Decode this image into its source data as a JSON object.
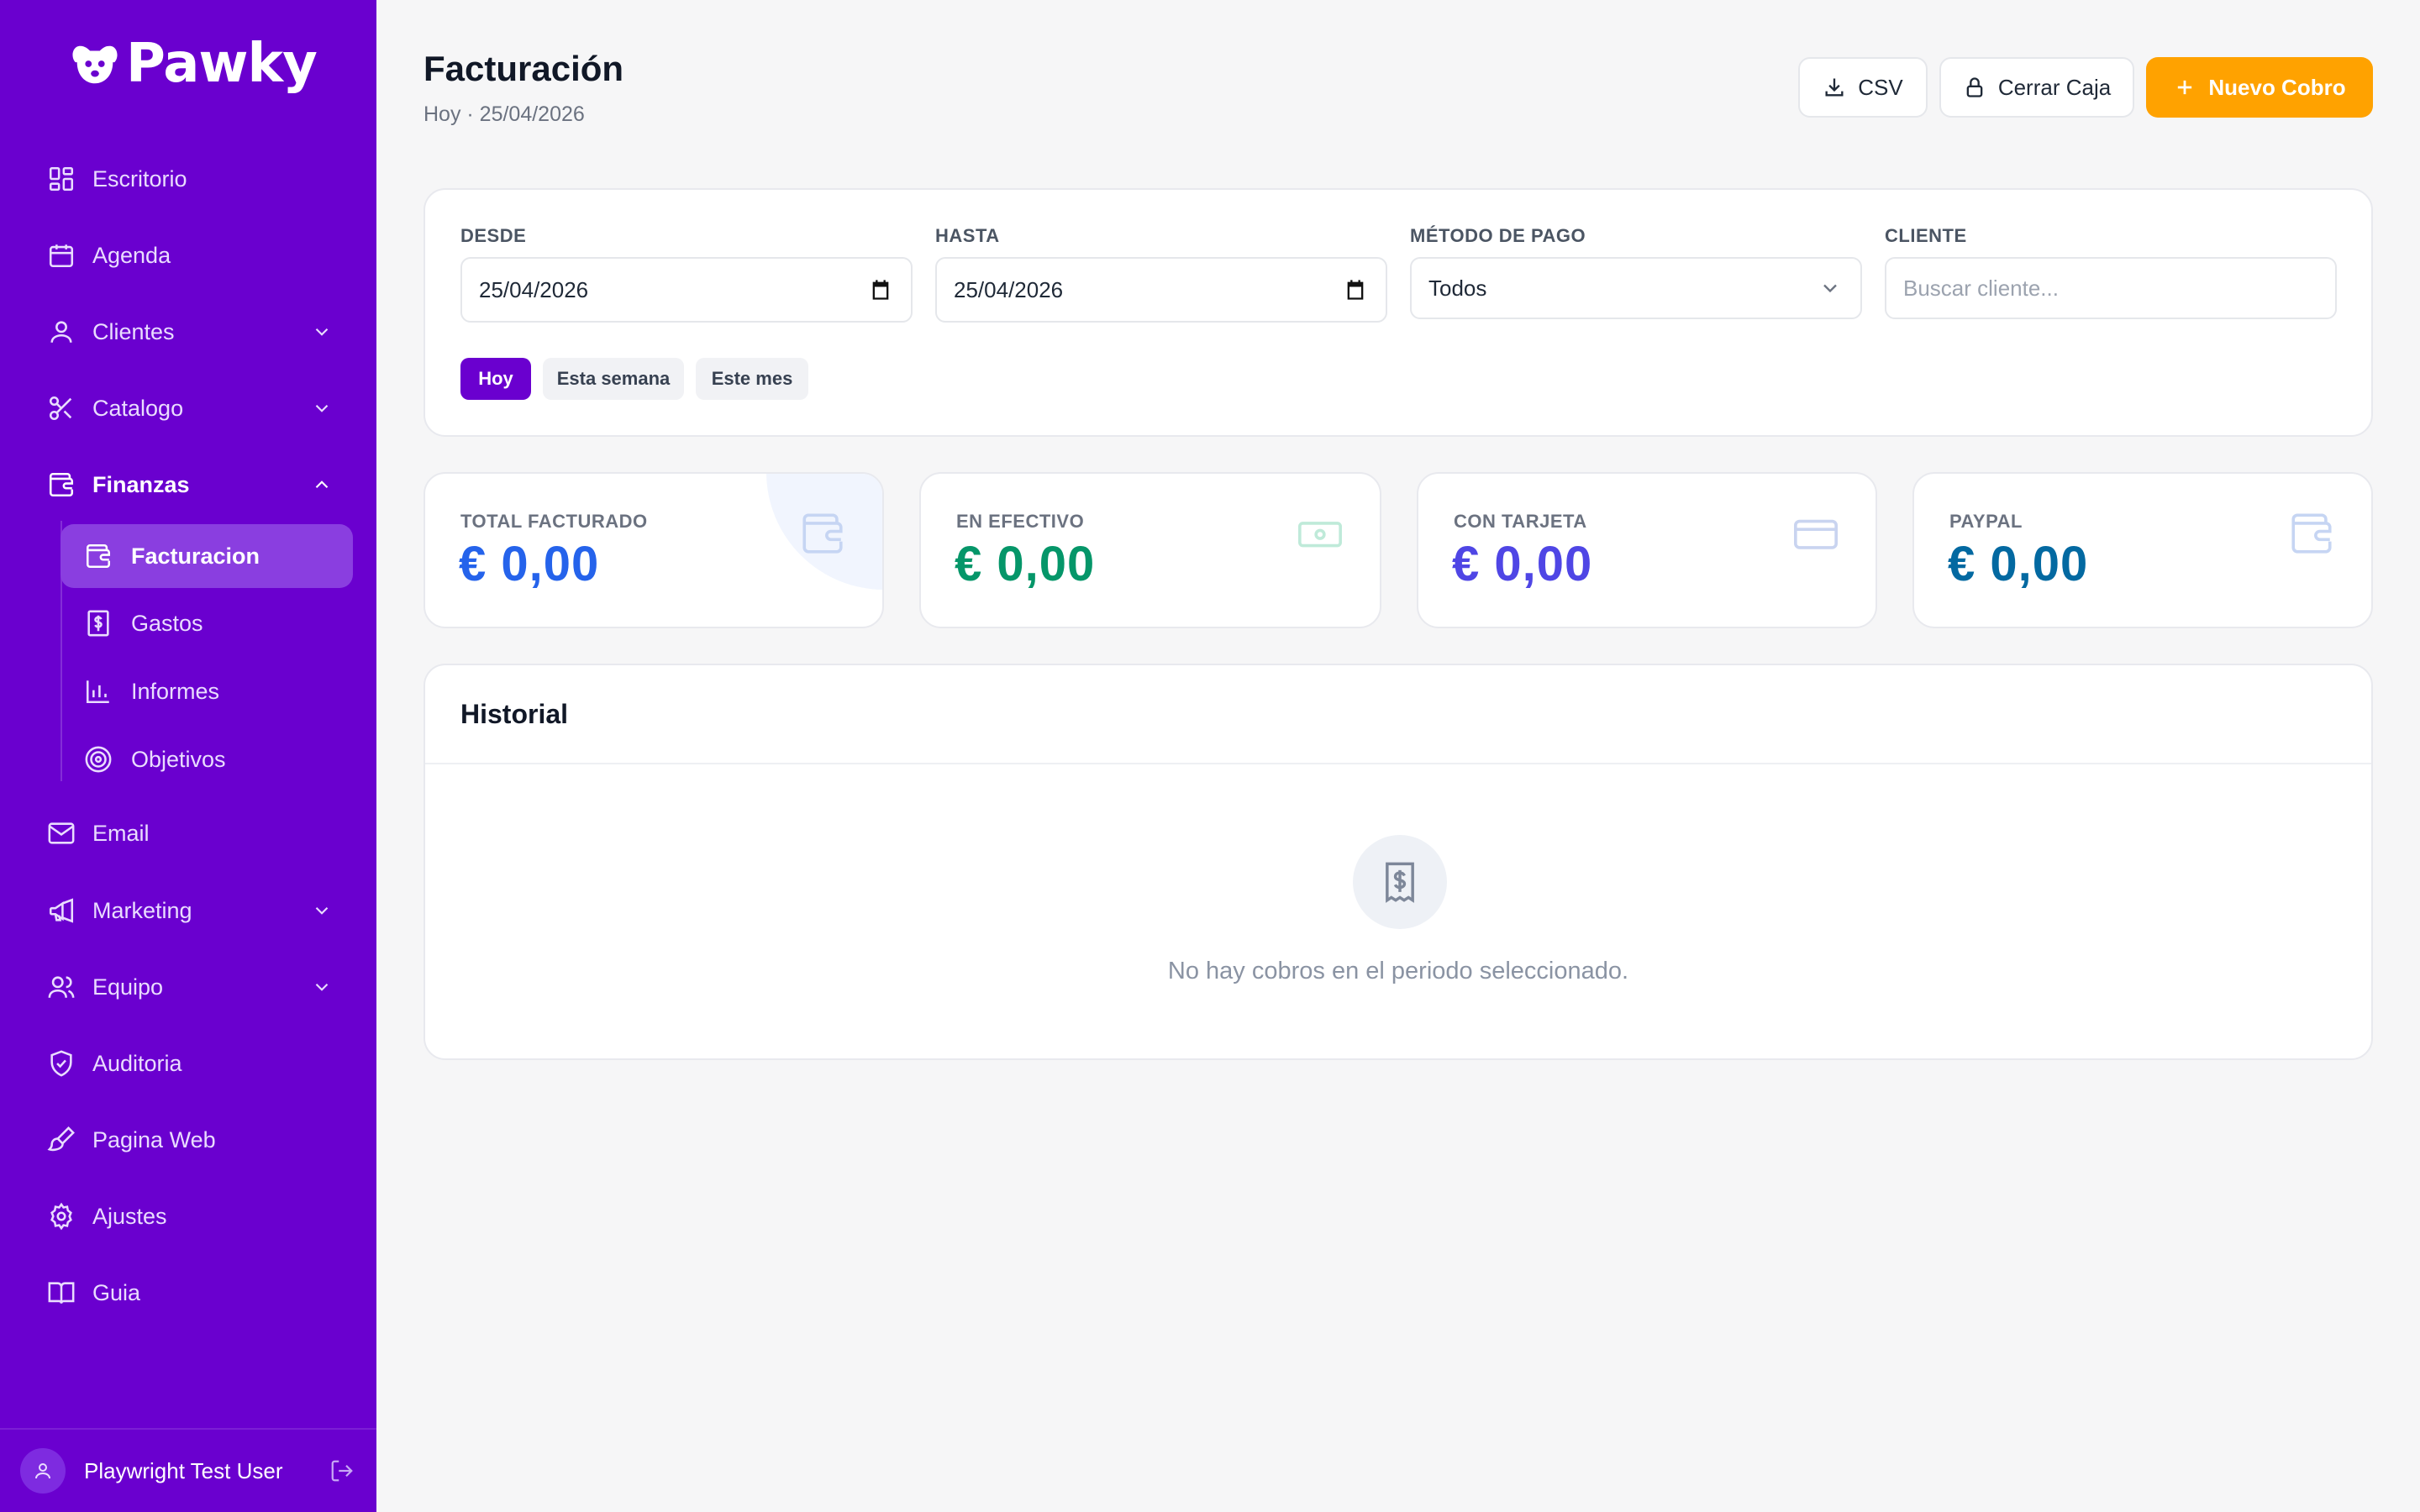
{
  "app": {
    "name": "Pawky"
  },
  "sidebar": {
    "items": [
      {
        "label": "Escritorio",
        "icon": "grid-icon"
      },
      {
        "label": "Agenda",
        "icon": "calendar-icon"
      },
      {
        "label": "Clientes",
        "icon": "user-icon"
      },
      {
        "label": "Catalogo",
        "icon": "scissors-icon"
      },
      {
        "label": "Finanzas",
        "icon": "wallet-icon"
      },
      {
        "label": "Email",
        "icon": "mail-icon"
      },
      {
        "label": "Marketing",
        "icon": "megaphone-icon"
      },
      {
        "label": "Equipo",
        "icon": "users-icon"
      },
      {
        "label": "Auditoria",
        "icon": "shield-icon"
      },
      {
        "label": "Pagina Web",
        "icon": "brush-icon"
      },
      {
        "label": "Ajustes",
        "icon": "gear-icon"
      },
      {
        "label": "Guia",
        "icon": "book-icon"
      }
    ],
    "finanzas_sub": [
      {
        "label": "Facturacion",
        "icon": "wallet-icon",
        "active": true
      },
      {
        "label": "Gastos",
        "icon": "receipt-icon"
      },
      {
        "label": "Informes",
        "icon": "bar-chart-icon"
      },
      {
        "label": "Objetivos",
        "icon": "target-icon"
      }
    ],
    "user": {
      "name": "Playwright Test User"
    }
  },
  "header": {
    "title": "Facturación",
    "subtitle": "Hoy · 25/04/2026",
    "buttons": {
      "csv": "CSV",
      "close_register": "Cerrar Caja",
      "new_charge": "Nuevo Cobro"
    }
  },
  "filters": {
    "from": {
      "label": "DESDE",
      "value": "25/04/2026"
    },
    "to": {
      "label": "HASTA",
      "value": "25/04/2026"
    },
    "payment_method": {
      "label": "MÉTODO DE PAGO",
      "value": "Todos"
    },
    "client": {
      "label": "CLIENTE",
      "placeholder": "Buscar cliente..."
    },
    "ranges": [
      "Hoy",
      "Esta semana",
      "Este mes"
    ],
    "selected_range": "Hoy"
  },
  "stats": [
    {
      "label": "TOTAL FACTURADO",
      "value": "€ 0,00",
      "color": "#2563eb",
      "icon": "wallet-icon"
    },
    {
      "label": "EN EFECTIVO",
      "value": "€ 0,00",
      "color": "#059669",
      "icon": "banknote-icon"
    },
    {
      "label": "CON TARJETA",
      "value": "€ 0,00",
      "color": "#4f46e5",
      "icon": "credit-card-icon"
    },
    {
      "label": "PAYPAL",
      "value": "€ 0,00",
      "color": "#0369a1",
      "icon": "wallet-icon"
    }
  ],
  "history": {
    "title": "Historial",
    "empty_message": "No hay cobros en el periodo seleccionado."
  },
  "colors": {
    "sidebar": "#6a00cf",
    "accent": "#ffa200",
    "active_item": "#8a3ee0"
  }
}
